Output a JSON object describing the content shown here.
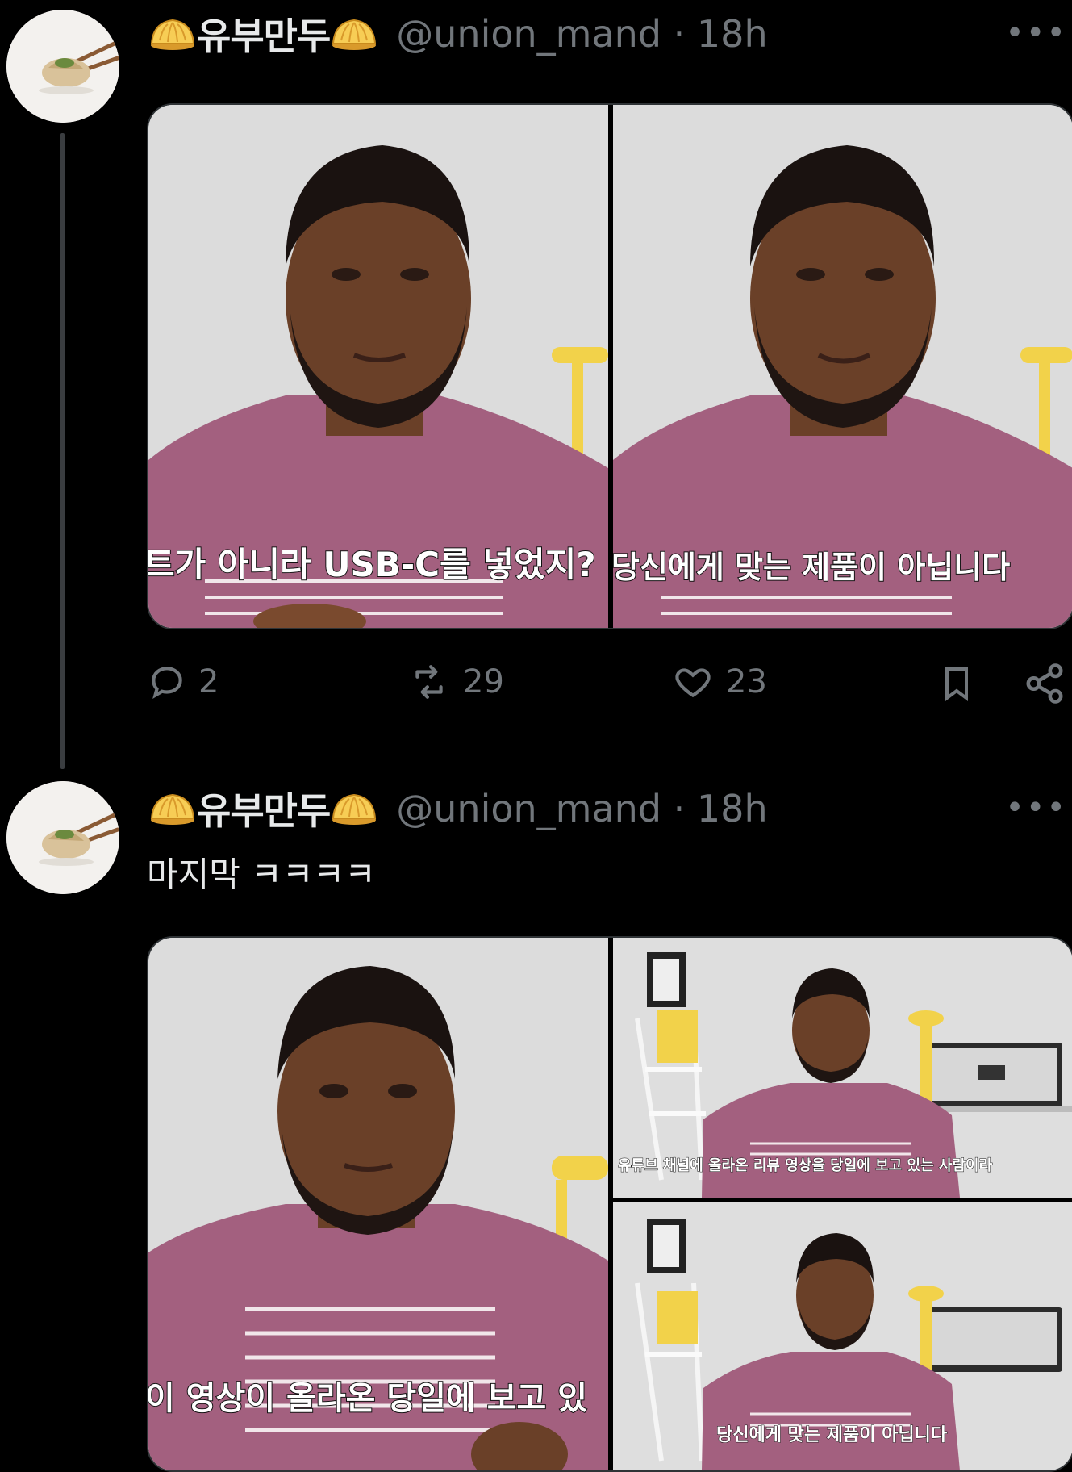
{
  "tweets": [
    {
      "display_name": "유부만두",
      "handle": "@union_mand",
      "time": "18h",
      "more_label": "•••",
      "media": [
        {
          "caption": "트가 아니라 USB-C를 넣었지?"
        },
        {
          "caption": "당신에게 맞는 제품이 아닙니다"
        }
      ],
      "actions": {
        "replies": "2",
        "retweets": "29",
        "likes": "23"
      }
    },
    {
      "display_name": "유부만두",
      "handle": "@union_mand",
      "time": "18h",
      "more_label": "•••",
      "text": "마지막 ㅋㅋㅋㅋ",
      "media": [
        {
          "caption": "이 영상이 올라온 당일에 보고 있"
        },
        {
          "caption": "유튜브 채널에 올라온 리뷰 영상을 당일에 보고 있는 사람이라"
        },
        {
          "caption": "당신에게 맞는 제품이 아닙니다"
        }
      ]
    }
  ],
  "colors": {
    "background": "#000000",
    "primary_text": "#e7e9ea",
    "secondary_text": "#71767b",
    "border": "#2f3336",
    "shirt": "#a3607f",
    "wall": "#dcdcdc",
    "lamp": "#f2d24a"
  },
  "icons": [
    "dumpling-emoji",
    "reply-icon",
    "retweet-icon",
    "like-icon",
    "bookmark-icon",
    "share-icon",
    "more-icon"
  ]
}
